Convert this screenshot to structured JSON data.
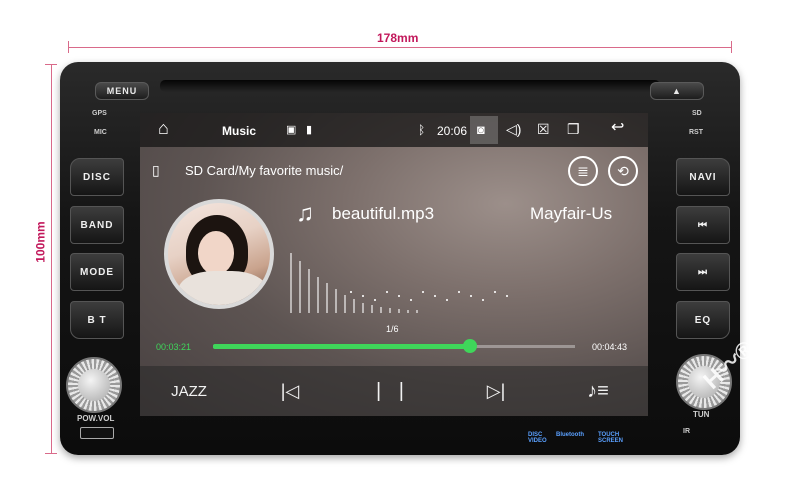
{
  "dimensions": {
    "width_label": "178mm",
    "height_label": "100mm"
  },
  "device": {
    "menu_label": "MENU",
    "gps_label": "GPS",
    "mic_label": "MIC",
    "sd_label": "SD",
    "rst_label": "RST",
    "left_buttons": [
      "DISC",
      "BAND",
      "MODE",
      "B T"
    ],
    "right_buttons": [
      "NAVI",
      "⏮",
      "⏭",
      "EQ"
    ],
    "pow_vol_label": "POW.VOL",
    "tun_label": "TUN",
    "ir_label": "IR",
    "logos": [
      "DISC VIDEO",
      "Bluetooth",
      "TOUCH SCREEN"
    ]
  },
  "statusbar": {
    "app_title": "Music",
    "clock": "20:06"
  },
  "player": {
    "folder_path": "SD Card/My favorite music/",
    "song_title": "beautiful.mp3",
    "artist": "Mayfair-Us",
    "track_position": "1/6",
    "elapsed": "00:03:21",
    "duration": "00:04:43",
    "progress": 0.71,
    "eq_preset": "JAZZ"
  },
  "colors": {
    "accent": "#3fd65a",
    "dimension_line": "#d96a8a",
    "dimension_text": "#c2185b"
  },
  "icons": {
    "home": "home-icon",
    "image": "image-icon",
    "sd": "sd-card-icon",
    "bluetooth": "bluetooth-icon",
    "camera": "camera-icon",
    "volume": "volume-icon",
    "close": "close-box-icon",
    "windows": "recent-apps-icon",
    "back": "back-icon",
    "eq": "equalizer-icon",
    "repeat": "repeat-icon",
    "note": "music-note-icon",
    "prev": "previous-icon",
    "pause": "pause-icon",
    "next": "next-icon",
    "playlist": "playlist-icon"
  }
}
